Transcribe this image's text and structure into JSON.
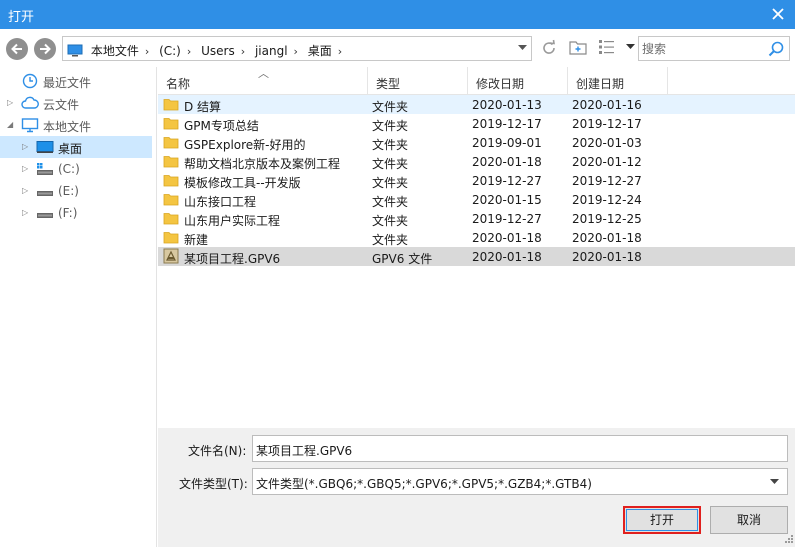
{
  "window": {
    "title": "打开"
  },
  "address": {
    "crumbs": [
      "本地文件",
      "(C:)",
      "Users",
      "jiangl",
      "桌面"
    ]
  },
  "search": {
    "placeholder": "搜索"
  },
  "sidebar": {
    "items": [
      {
        "label": "最近文件",
        "icon": "clock-icon"
      },
      {
        "label": "云文件",
        "icon": "cloud-icon"
      },
      {
        "label": "本地文件",
        "icon": "monitor-icon"
      },
      {
        "label": "桌面",
        "icon": "desktop-icon"
      },
      {
        "label": "(C:)",
        "icon": "drive-c-icon"
      },
      {
        "label": "(E:)",
        "icon": "drive-icon"
      },
      {
        "label": "(F:)",
        "icon": "drive-icon"
      }
    ]
  },
  "list": {
    "columns": [
      "名称",
      "类型",
      "修改日期",
      "创建日期"
    ],
    "rows": [
      {
        "name": "D 结算",
        "type": "文件夹",
        "modified": "2020-01-13",
        "created": "2020-01-16"
      },
      {
        "name": "GPM专项总结",
        "type": "文件夹",
        "modified": "2019-12-17",
        "created": "2019-12-17"
      },
      {
        "name": "GSPExplore新-好用的",
        "type": "文件夹",
        "modified": "2019-09-01",
        "created": "2020-01-03"
      },
      {
        "name": "帮助文档北京版本及案例工程",
        "type": "文件夹",
        "modified": "2020-01-18",
        "created": "2020-01-12"
      },
      {
        "name": "模板修改工具--开发版",
        "type": "文件夹",
        "modified": "2019-12-27",
        "created": "2019-12-27"
      },
      {
        "name": "山东接口工程",
        "type": "文件夹",
        "modified": "2020-01-15",
        "created": "2019-12-24"
      },
      {
        "name": "山东用户实际工程",
        "type": "文件夹",
        "modified": "2019-12-27",
        "created": "2019-12-25"
      },
      {
        "name": "新建",
        "type": "文件夹",
        "modified": "2020-01-18",
        "created": "2020-01-18"
      },
      {
        "name": "某项目工程.GPV6",
        "type": "GPV6 文件",
        "modified": "2020-01-18",
        "created": "2020-01-18"
      }
    ]
  },
  "bottom": {
    "filename_label": "文件名(N):",
    "filename_value": "某项目工程.GPV6",
    "filetype_label": "文件类型(T):",
    "filetype_value": "文件类型(*.GBQ6;*.GBQ5;*.GPV6;*.GPV5;*.GZB4;*.GTB4)",
    "open_label": "打开",
    "cancel_label": "取消"
  },
  "colors": {
    "titlebar": "#2f8fe6",
    "selection": "#cde8ff",
    "folder": "#f4c542",
    "primary_border": "#e0201e"
  }
}
